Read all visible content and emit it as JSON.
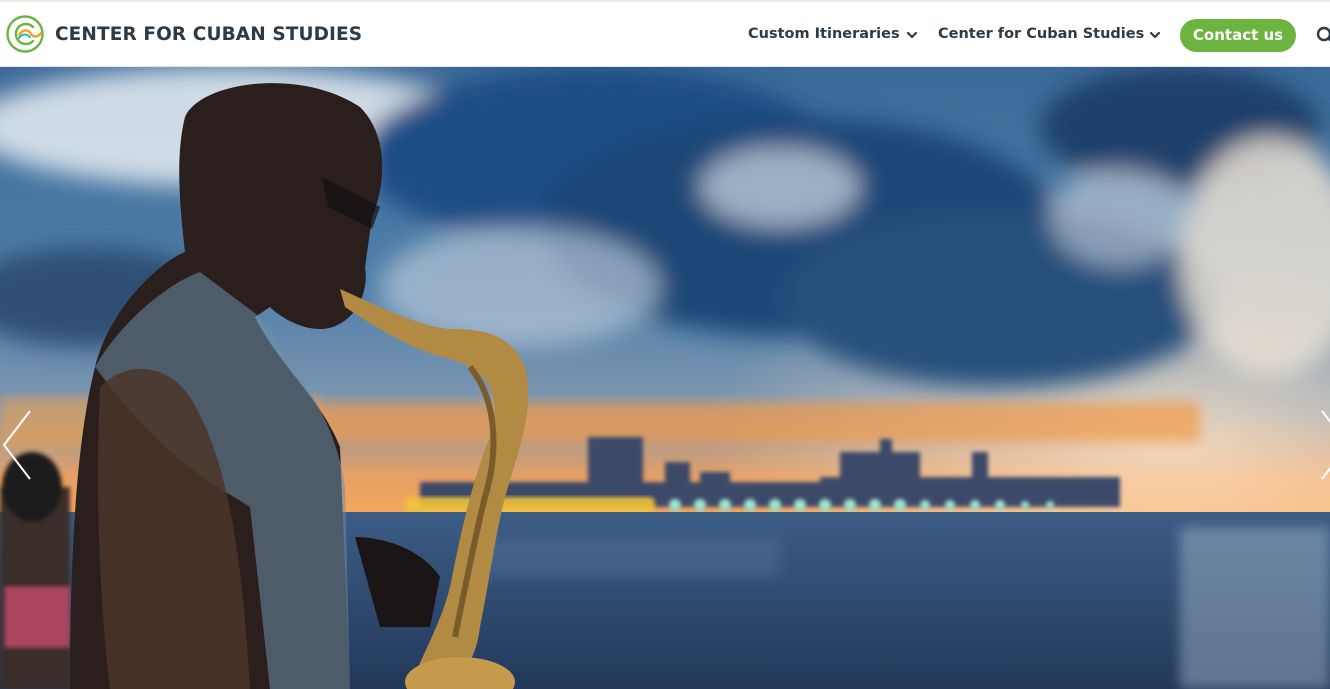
{
  "brand": {
    "name": "CENTER FOR CUBAN STUDIES",
    "logo_icon": "swirl-logo-icon",
    "colors": {
      "dark": "#2c3b46",
      "green": "#6db33f",
      "orange": "#f2a02a",
      "teal": "#2bb5a8"
    }
  },
  "nav": {
    "items": [
      {
        "label": "Custom Itineraries",
        "icon": "chevron-down-icon"
      },
      {
        "label": "Center for Cuban Studies",
        "icon": "chevron-down-icon"
      }
    ],
    "contact_label": "Contact us",
    "contact_color": "#6db33f",
    "search_icon": "search-icon"
  },
  "hero": {
    "image": "saxophone-player-at-malecon-sunset",
    "prev_icon": "chevron-left-icon",
    "next_icon": "chevron-right-icon"
  }
}
